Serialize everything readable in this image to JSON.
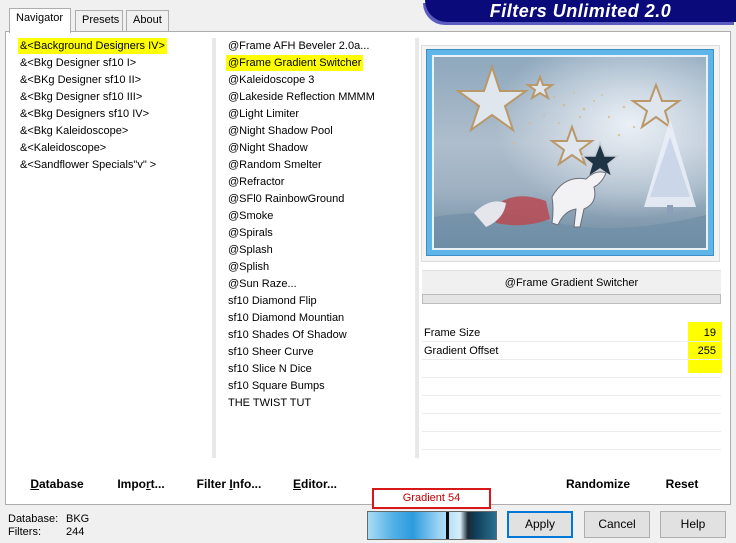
{
  "app": {
    "title": "Filters Unlimited 2.0"
  },
  "tabs": [
    {
      "label": "Navigator",
      "active": true
    },
    {
      "label": "Presets",
      "active": false
    },
    {
      "label": "About",
      "active": false
    }
  ],
  "categories": [
    {
      "label": "&<Background Designers IV>",
      "highlighted": true
    },
    {
      "label": "&<Bkg Designer sf10 I>",
      "highlighted": false
    },
    {
      "label": "&<BKg Designer sf10 II>",
      "highlighted": false
    },
    {
      "label": "&<Bkg Designer sf10 III>",
      "highlighted": false
    },
    {
      "label": "&<Bkg Designers sf10 IV>",
      "highlighted": false
    },
    {
      "label": "&<Bkg Kaleidoscope>",
      "highlighted": false
    },
    {
      "label": "&<Kaleidoscope>",
      "highlighted": false
    },
    {
      "label": "&<Sandflower Specials\"v\" >",
      "highlighted": false
    }
  ],
  "filters": [
    {
      "label": "@Frame AFH Beveler 2.0a...",
      "highlighted": false
    },
    {
      "label": "@Frame Gradient Switcher",
      "highlighted": true
    },
    {
      "label": "@Kaleidoscope 3",
      "highlighted": false
    },
    {
      "label": "@Lakeside Reflection MMMM",
      "highlighted": false
    },
    {
      "label": "@Light Limiter",
      "highlighted": false
    },
    {
      "label": "@Night Shadow Pool",
      "highlighted": false
    },
    {
      "label": "@Night Shadow",
      "highlighted": false
    },
    {
      "label": "@Random Smelter",
      "highlighted": false
    },
    {
      "label": "@Refractor",
      "highlighted": false
    },
    {
      "label": "@SFl0 RainbowGround",
      "highlighted": false
    },
    {
      "label": "@Smoke",
      "highlighted": false
    },
    {
      "label": "@Spirals",
      "highlighted": false
    },
    {
      "label": "@Splash",
      "highlighted": false
    },
    {
      "label": "@Splish",
      "highlighted": false
    },
    {
      "label": "@Sun Raze...",
      "highlighted": false
    },
    {
      "label": "sf10 Diamond Flip",
      "highlighted": false
    },
    {
      "label": "sf10 Diamond Mountian",
      "highlighted": false
    },
    {
      "label": "sf10 Shades Of Shadow",
      "highlighted": false
    },
    {
      "label": "sf10 Sheer Curve",
      "highlighted": false
    },
    {
      "label": "sf10 Slice N Dice",
      "highlighted": false
    },
    {
      "label": "sf10 Square Bumps",
      "highlighted": false
    },
    {
      "label": "THE TWIST TUT",
      "highlighted": false
    }
  ],
  "selected_filter": "@Frame Gradient Switcher",
  "params": [
    {
      "label": "Frame Size",
      "value": "19"
    },
    {
      "label": "Gradient Offset",
      "value": "255"
    }
  ],
  "toolbar": {
    "database": {
      "accel": "D",
      "rest": "atabase"
    },
    "import": {
      "pre": "Impo",
      "accel": "r",
      "post": "t..."
    },
    "filter_info": {
      "pre": "Filter ",
      "accel": "I",
      "post": "nfo..."
    },
    "editor": {
      "accel": "E",
      "rest": "ditor..."
    },
    "randomize": "Randomize",
    "reset": "Reset"
  },
  "footer": {
    "database_label": "Database:",
    "database_value": "BKG",
    "filters_label": "Filters:",
    "filters_value": "244",
    "gradient_name": "Gradient 54"
  },
  "buttons": {
    "apply": "Apply",
    "cancel": "Cancel",
    "help": "Help"
  },
  "colors": {
    "highlight": "#ffff00",
    "banner": "#0a0a7a",
    "preview_border": "#5fb4e8",
    "gradient_label_border": "#d81818"
  },
  "preview_image": {
    "subject": "wintry scene with stars, a white horse pulling a sleigh, and a frosted tree",
    "icons": [
      "star-icon",
      "horse-icon",
      "tree-icon"
    ]
  }
}
